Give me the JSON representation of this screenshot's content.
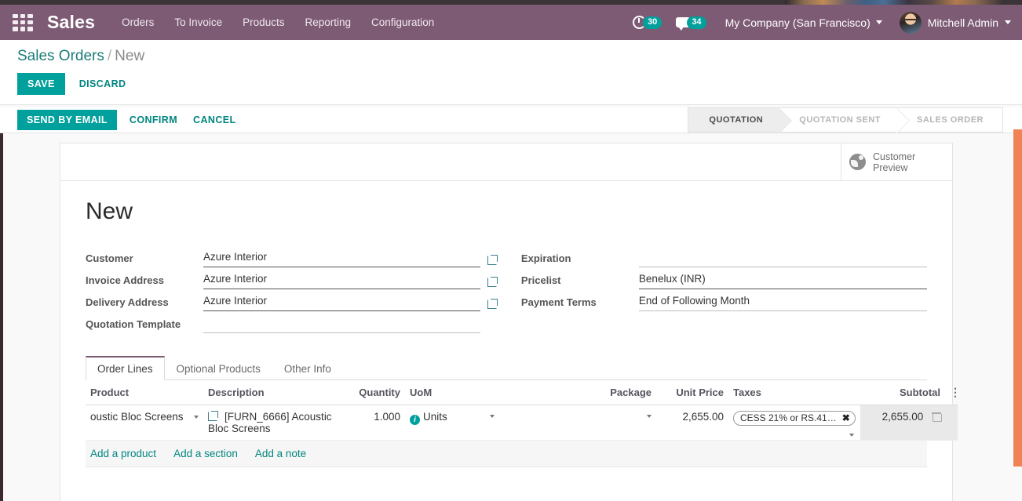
{
  "navbar": {
    "apps_icon": "apps-grid-icon",
    "brand": "Sales",
    "menu": [
      "Orders",
      "To Invoice",
      "Products",
      "Reporting",
      "Configuration"
    ],
    "activity_icon": "clock-icon",
    "activity_count": "30",
    "messaging_icon": "chat-icon",
    "messaging_count": "34",
    "company": "My Company (San Francisco)",
    "user": "Mitchell Admin",
    "accent_color": "#7d5b74",
    "badge_color": "#00a09d"
  },
  "breadcrumb": {
    "root": "Sales Orders",
    "separator": "/",
    "current": "New"
  },
  "edit_actions": {
    "save": "SAVE",
    "discard": "DISCARD"
  },
  "statusbar_actions": {
    "send_by_email": "SEND BY EMAIL",
    "confirm": "CONFIRM",
    "cancel": "CANCEL"
  },
  "statusbar": {
    "stages": [
      "QUOTATION",
      "QUOTATION SENT",
      "SALES ORDER"
    ],
    "active": "QUOTATION"
  },
  "customer_preview": {
    "icon": "globe-icon",
    "line1": "Customer",
    "line2": "Preview"
  },
  "record": {
    "title": "New"
  },
  "form": {
    "left": [
      {
        "label": "Customer",
        "value": "Azure Interior",
        "filled": true,
        "external_link": true
      },
      {
        "label": "Invoice Address",
        "value": "Azure Interior",
        "filled": true,
        "external_link": true
      },
      {
        "label": "Delivery Address",
        "value": "Azure Interior",
        "filled": true,
        "external_link": true
      },
      {
        "label": "Quotation Template",
        "value": "",
        "filled": false,
        "external_link": false
      }
    ],
    "right": [
      {
        "label": "Expiration",
        "value": "",
        "filled": false
      },
      {
        "label": "Pricelist",
        "value": "Benelux (INR)",
        "filled": true
      },
      {
        "label": "Payment Terms",
        "value": "End of Following Month",
        "filled": true
      }
    ]
  },
  "notebook": {
    "tabs": [
      "Order Lines",
      "Optional Products",
      "Other Info"
    ],
    "active_tab": "Order Lines"
  },
  "order_lines": {
    "headers": {
      "product": "Product",
      "description": "Description",
      "quantity": "Quantity",
      "uom": "UoM",
      "package": "Package",
      "unit_price": "Unit Price",
      "taxes": "Taxes",
      "subtotal": "Subtotal",
      "options": "options-icon"
    },
    "rows": [
      {
        "product": "oustic Bloc Screens",
        "description": "[FURN_6666] Acoustic Bloc Screens",
        "quantity": "1.000",
        "uom": "Units",
        "package": "",
        "unit_price": "2,655.00",
        "tax_tag": "CESS 21% or RS.41…",
        "tax_remove": "✖",
        "subtotal": "2,655.00",
        "delete_icon": "trash-icon"
      }
    ],
    "add_links": [
      "Add a product",
      "Add a section",
      "Add a note"
    ]
  }
}
